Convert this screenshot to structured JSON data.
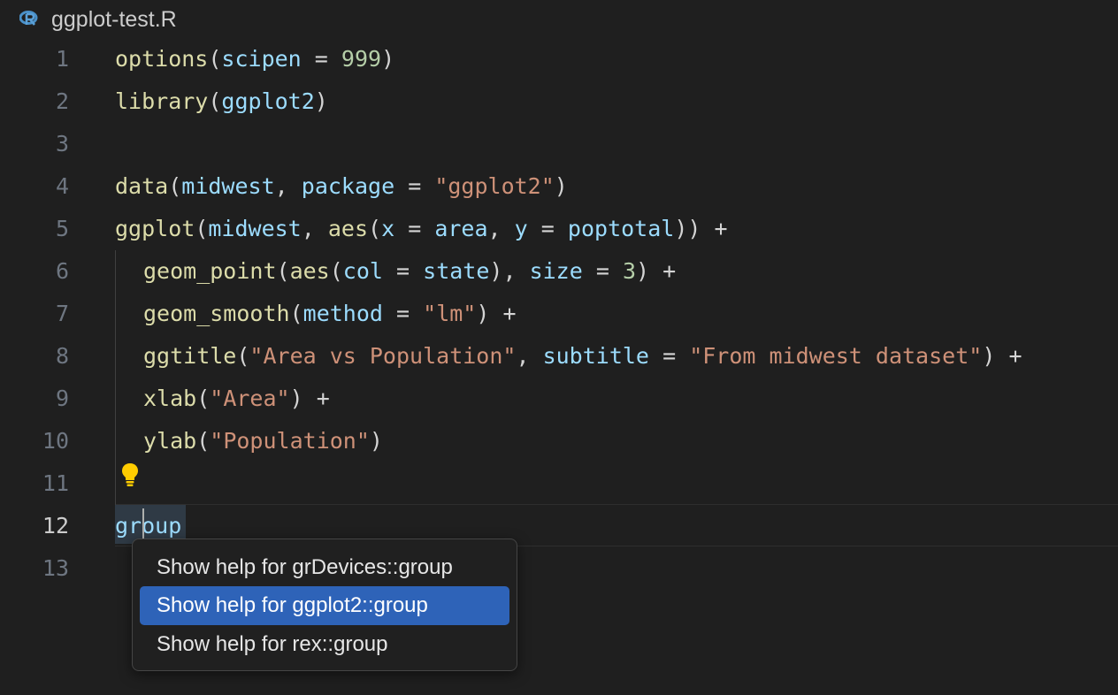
{
  "tab": {
    "icon": "r-language-icon",
    "title": "ggplot-test.R"
  },
  "editor": {
    "line_numbers": [
      "1",
      "2",
      "3",
      "4",
      "5",
      "6",
      "7",
      "8",
      "9",
      "10",
      "11",
      "12",
      "13"
    ],
    "active_line": "12",
    "current_word": "group"
  },
  "context_menu": {
    "items": [
      {
        "label": "Show help for grDevices::group",
        "selected": false
      },
      {
        "label": "Show help for ggplot2::group",
        "selected": true
      },
      {
        "label": "Show help for rex::group",
        "selected": false
      }
    ]
  },
  "colors": {
    "background": "#1f1f1f",
    "function": "#dcdcaa",
    "variable": "#9cdcfe",
    "number": "#b5cea8",
    "string": "#ce9178",
    "menu_selected": "#2e63b8"
  }
}
